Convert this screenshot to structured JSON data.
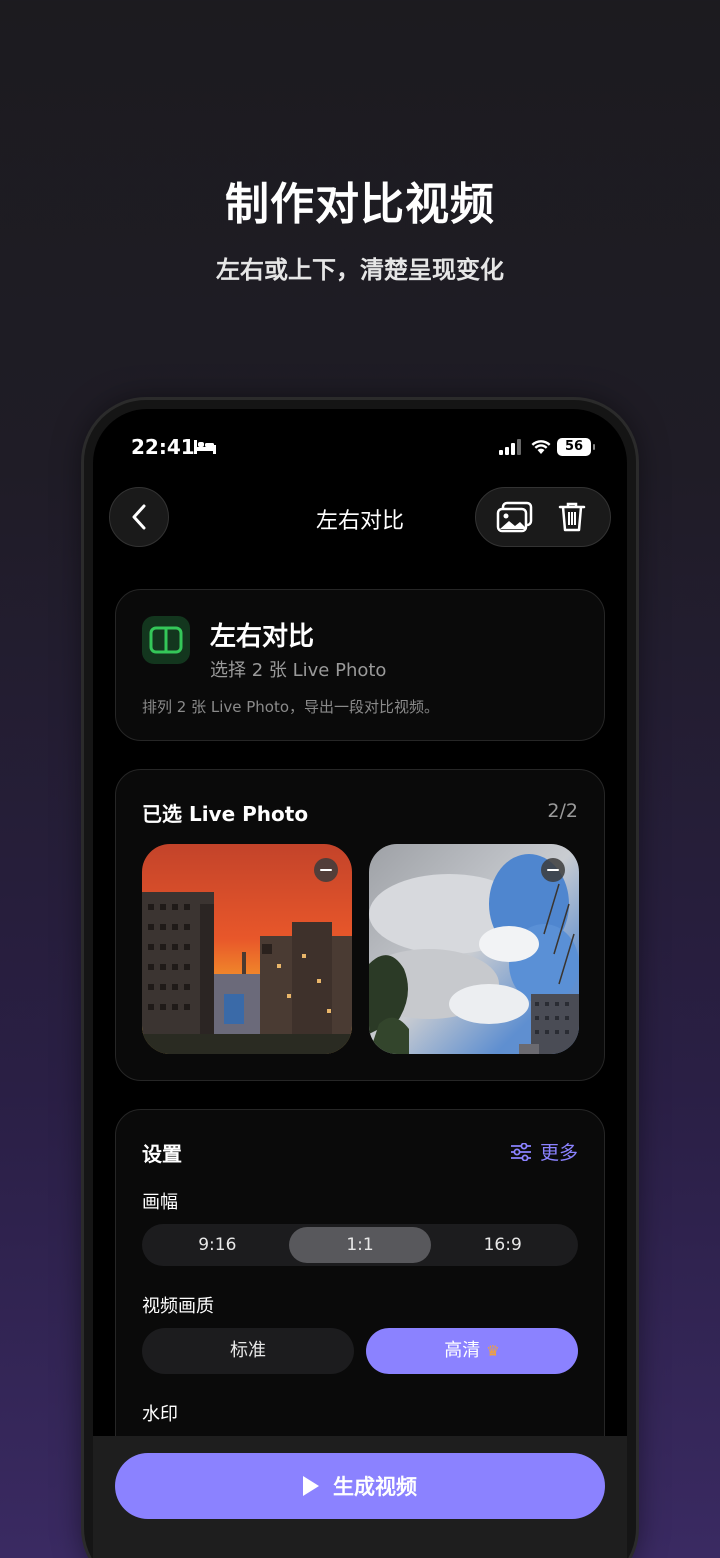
{
  "hero": {
    "title": "制作对比视频",
    "subtitle": "左右或上下，清楚呈现变化"
  },
  "status_bar": {
    "time": "22:41",
    "battery": "56"
  },
  "nav": {
    "title": "左右对比"
  },
  "mode_card": {
    "title": "左右对比",
    "subtitle": "选择 2 张 Live Photo",
    "description": "排列 2 张 Live Photo，导出一段对比视频。"
  },
  "selected_card": {
    "title": "已选 Live Photo",
    "count": "2/2"
  },
  "settings": {
    "title": "设置",
    "more_label": "更多",
    "aspect_label": "画幅",
    "aspect_options": [
      "9:16",
      "1:1",
      "16:9"
    ],
    "aspect_selected": "1:1",
    "quality_label": "视频画质",
    "quality_options": [
      "标准",
      "高清"
    ],
    "quality_selected": "高清",
    "watermark_label": "水印"
  },
  "generate_button": {
    "label": "生成视频"
  },
  "colors": {
    "accent": "#8b82ff",
    "mode_icon_green": "#34c759",
    "crown": "#f4a23a"
  }
}
